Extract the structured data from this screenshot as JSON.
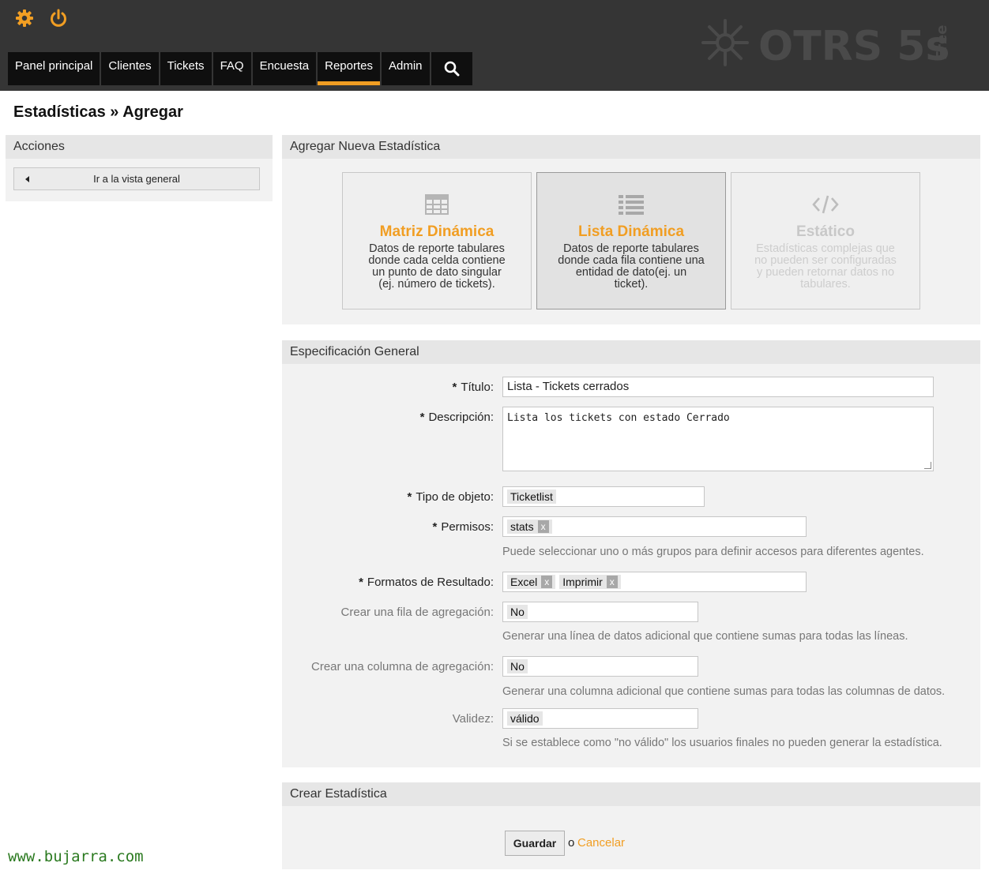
{
  "header": {
    "logo_text": "OTRS 5s",
    "logo_edition": "Free",
    "nav": [
      {
        "label": "Panel principal"
      },
      {
        "label": "Clientes"
      },
      {
        "label": "Tickets"
      },
      {
        "label": "FAQ"
      },
      {
        "label": "Encuesta"
      },
      {
        "label": "Reportes",
        "active": true
      },
      {
        "label": "Admin"
      }
    ],
    "icons": [
      "gear-icon",
      "power-icon",
      "search-icon"
    ],
    "accent_color": "#f19e23"
  },
  "page_title": "Estadísticas » Agregar",
  "sidebar": {
    "title": "Acciones",
    "button_label": "Ir a la vista general"
  },
  "new_stat": {
    "title": "Agregar Nueva Estadística",
    "cards": [
      {
        "title": "Matriz Dinámica",
        "desc": "Datos de reporte tabulares donde cada celda contiene un punto de dato singular (ej. número de tickets).",
        "icon": "table-icon"
      },
      {
        "title": "Lista Dinámica",
        "desc": "Datos de reporte tabulares donde cada fila contiene una entidad de dato(ej. un ticket).",
        "icon": "list-icon",
        "selected": true
      },
      {
        "title": "Estático",
        "desc": "Estadísticas complejas que no pueden ser configuradas y pueden retornar datos no tabulares.",
        "icon": "code-icon",
        "disabled": true
      }
    ]
  },
  "general": {
    "title": "Especificación General",
    "titulo_label": "Título:",
    "titulo_value": "Lista - Tickets cerrados",
    "descripcion_label": "Descripción:",
    "descripcion_value": "Lista los tickets con estado Cerrado",
    "tipo_label": "Tipo de objeto:",
    "tipo_value": "Ticketlist",
    "permisos_label": "Permisos:",
    "permisos_tags": [
      "stats"
    ],
    "permisos_hint": "Puede seleccionar uno o más grupos para definir accesos para diferentes agentes.",
    "formatos_label": "Formatos de Resultado:",
    "formatos_tags": [
      "Excel",
      "Imprimir"
    ],
    "fila_label": "Crear una fila de agregación:",
    "fila_value": "No",
    "fila_hint": "Generar una línea de datos adicional que contiene sumas para todas las líneas.",
    "columna_label": "Crear una columna de agregación:",
    "columna_value": "No",
    "columna_hint": "Generar una columna adicional que contiene sumas para todas las columnas de datos.",
    "validez_label": "Validez:",
    "validez_value": "válido",
    "validez_hint": "Si se establece como \"no válido\" los usuarios finales no pueden generar la estadística.",
    "required_mark": "*"
  },
  "create": {
    "title": "Crear Estadística",
    "save_label": "Guardar",
    "or_text": "o",
    "cancel_label": "Cancelar"
  },
  "watermark": "www.bujarra.com"
}
